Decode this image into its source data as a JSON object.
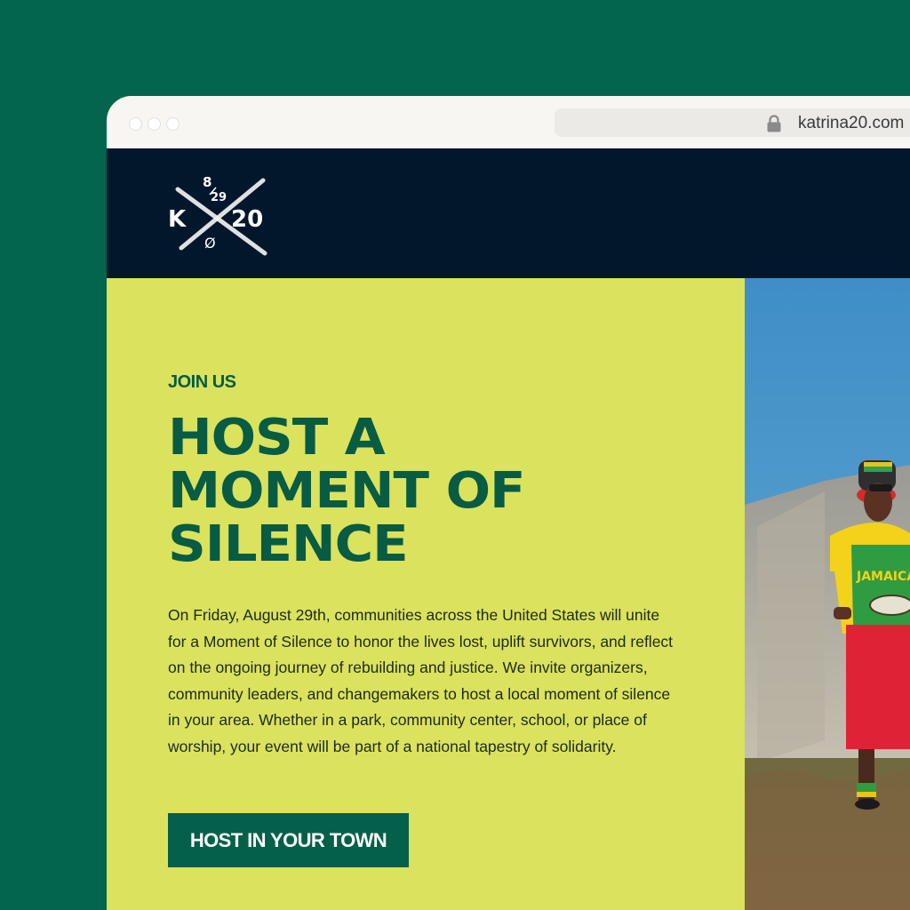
{
  "browser": {
    "url": "katrina20.com"
  },
  "navbar": {
    "logo": {
      "date_top": "8",
      "date_bottom": "29",
      "left_letter": "K",
      "right_number": "20",
      "zero_mark": "Ø"
    }
  },
  "hero": {
    "eyebrow": "JOIN US",
    "headline_lines": [
      "HOST A",
      "MOMENT OF",
      "SILENCE"
    ],
    "body": "On Friday, August 29th, communities across the United States will unite for a Moment of Silence to honor the lives lost, uplift survivors, and reflect on the ongoing journey of rebuilding and justice. We invite organizers, community leaders, and changemakers to host a local moment of silence in your area. Whether in a park, community center, school, or place of worship, your event will be part of a national tapestry of solidarity.",
    "cta_label": "HOST IN YOUR TOWN",
    "photo_shirt_text": "JAMAICA"
  },
  "colors": {
    "background": "#04654d",
    "nav": "#02172b",
    "hero_bg": "#dbe25e",
    "brand_green": "#075c43",
    "button": "#05604a"
  },
  "icons": [
    "window-dot-icon",
    "lock-icon",
    "katrina20-logo"
  ]
}
